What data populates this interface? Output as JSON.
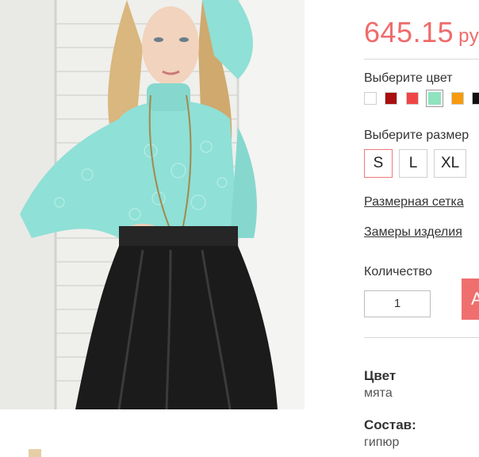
{
  "product": {
    "price": "645.15",
    "currency": "руб"
  },
  "color_picker": {
    "label": "Выберите цвет",
    "swatches": [
      {
        "name": "white",
        "color": "#ffffff",
        "selected": false
      },
      {
        "name": "dark-red",
        "color": "#a80f0f",
        "selected": false
      },
      {
        "name": "red",
        "color": "#f04545",
        "selected": false
      },
      {
        "name": "mint",
        "color": "#8fe3bf",
        "selected": true
      },
      {
        "name": "orange",
        "color": "#f79a0d",
        "selected": false
      },
      {
        "name": "black",
        "color": "#111111",
        "selected": false
      }
    ]
  },
  "size_picker": {
    "label": "Выберите размер",
    "sizes": [
      "S",
      "L",
      "XL"
    ],
    "selected": "S"
  },
  "links": {
    "size_chart": "Размерная сетка",
    "measurements": "Замеры изделия"
  },
  "quantity": {
    "label": "Количество",
    "value": "1"
  },
  "add_button": {
    "label": "A"
  },
  "specs": {
    "color_title": "Цвет",
    "color_value": "мята",
    "composition_title": "Состав:",
    "composition_value": "гипюр"
  },
  "colors": {
    "accent": "#ef6b6b",
    "top_color": "#8fe0d6",
    "skirt_color": "#1b1b1b"
  }
}
